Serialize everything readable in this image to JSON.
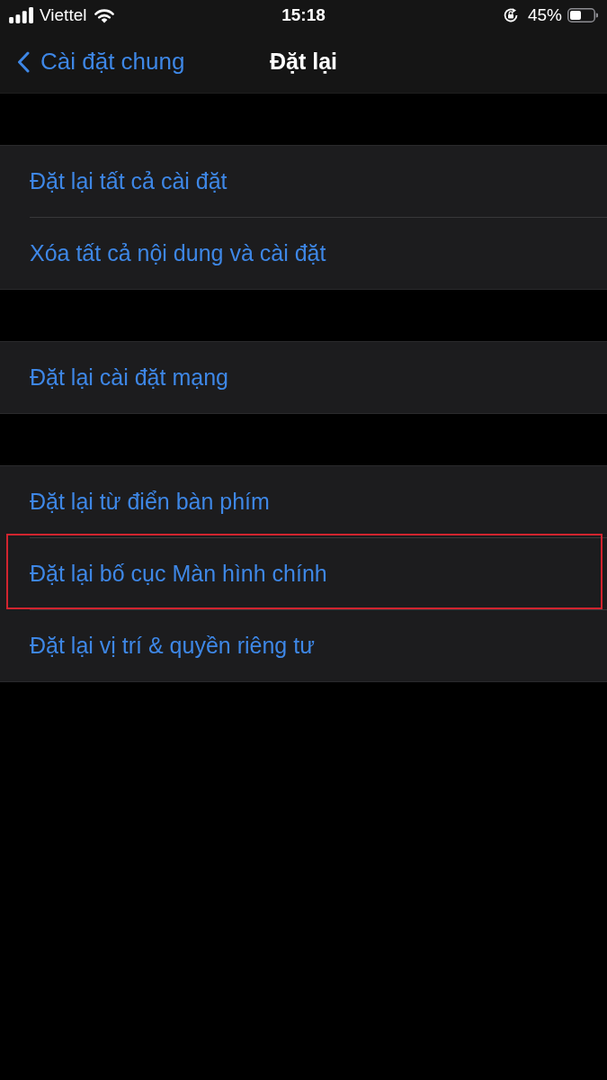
{
  "status_bar": {
    "carrier": "Viettel",
    "time": "15:18",
    "battery_percent": "45%"
  },
  "nav_bar": {
    "back_label": "Cài đặt chung",
    "title": "Đặt lại"
  },
  "groups": [
    {
      "rows": [
        {
          "label": "Đặt lại tất cả cài đặt",
          "highlighted": false
        },
        {
          "label": "Xóa tất cả nội dung và cài đặt",
          "highlighted": false
        }
      ]
    },
    {
      "rows": [
        {
          "label": "Đặt lại cài đặt mạng",
          "highlighted": false
        }
      ]
    },
    {
      "rows": [
        {
          "label": "Đặt lại từ điển bàn phím",
          "highlighted": false
        },
        {
          "label": "Đặt lại bố cục Màn hình chính",
          "highlighted": true
        },
        {
          "label": "Đặt lại vị trí & quyền riêng tư",
          "highlighted": false
        }
      ]
    }
  ]
}
